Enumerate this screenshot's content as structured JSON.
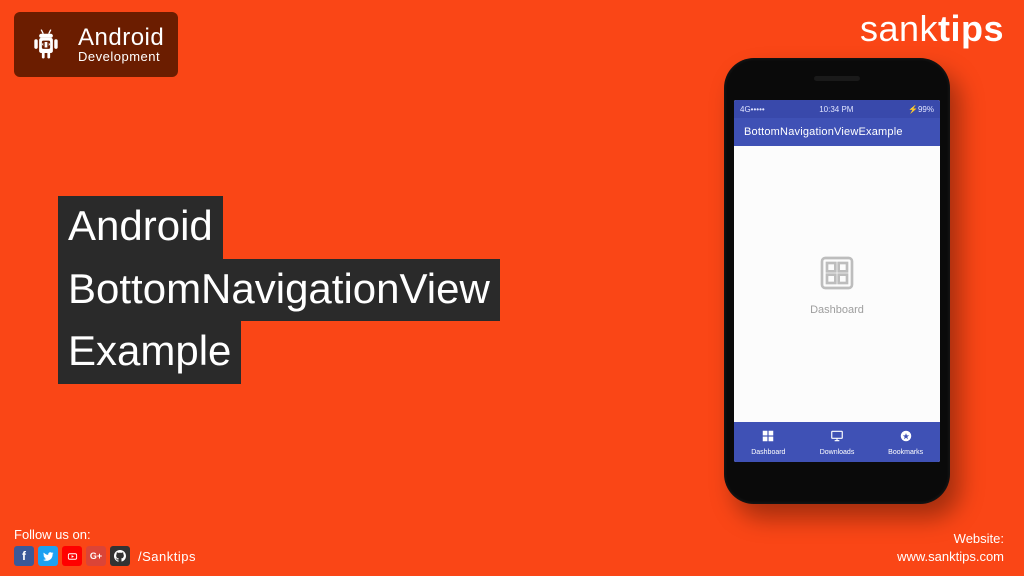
{
  "badge": {
    "title": "Android",
    "subtitle": "Development"
  },
  "brand": {
    "light": "sank",
    "bold": "tips"
  },
  "headline": {
    "line1": "Android",
    "line2": "BottomNavigationView",
    "line3": "Example"
  },
  "footer": {
    "follow_label": "Follow us on:",
    "handle": "/Sanktips",
    "website_label": "Website:",
    "website_url": "www.sanktips.com"
  },
  "phone": {
    "status": {
      "left": "4G•••••",
      "time": "10:34 PM",
      "right": "⚡99%"
    },
    "appbar_title": "BottomNavigationViewExample",
    "content_label": "Dashboard",
    "nav": [
      {
        "label": "Dashboard"
      },
      {
        "label": "Downloads"
      },
      {
        "label": "Bookmarks"
      }
    ]
  }
}
